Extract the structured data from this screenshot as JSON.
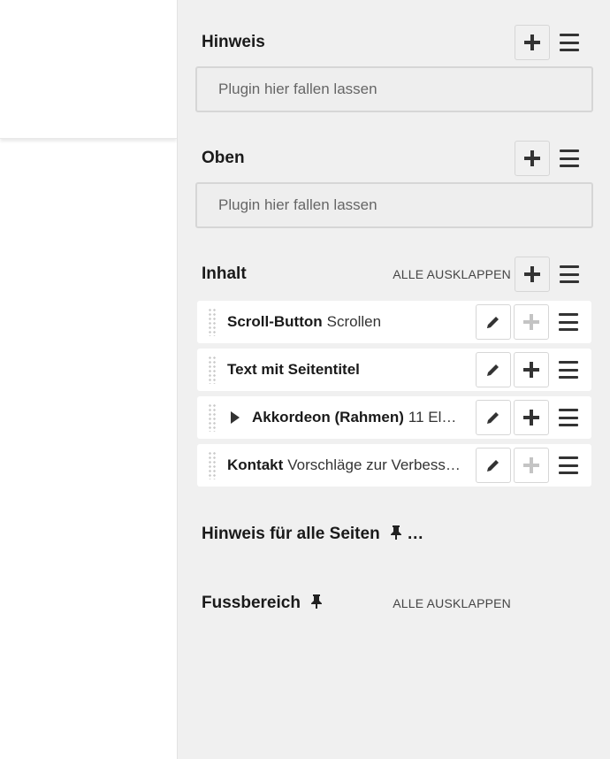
{
  "placeholders": [
    {
      "title": "Hinweis",
      "dropzone": "Plugin hier fallen lassen"
    },
    {
      "title": "Oben",
      "dropzone": "Plugin hier fallen lassen"
    },
    {
      "title": "Inhalt",
      "expand_label": "ALLE AUSKLAPPEN",
      "plugins": [
        {
          "type": "Scroll-Button",
          "desc": "Scrollen",
          "add_enabled": false
        },
        {
          "type": "Text mit Seitentitel",
          "desc": "",
          "add_enabled": true
        },
        {
          "type": "Akkordeon (Rahmen)",
          "desc": "11 El…",
          "add_enabled": true,
          "collapsible": true
        },
        {
          "type": "Kontakt",
          "desc": "Vorschläge zur Verbess…",
          "add_enabled": false
        }
      ]
    },
    {
      "title": "Hinweis für alle Seiten",
      "suffix": "…",
      "pinned": true
    },
    {
      "title": "Fussbereich",
      "pinned": true,
      "expand_label": "ALLE AUSKLAPPEN"
    }
  ],
  "icons": {
    "add": "plus-icon",
    "menu": "hamburger-icon",
    "edit": "pencil-icon",
    "drag": "drag-handle-icon",
    "pin": "pin-icon",
    "expand": "triangle-right-icon"
  }
}
